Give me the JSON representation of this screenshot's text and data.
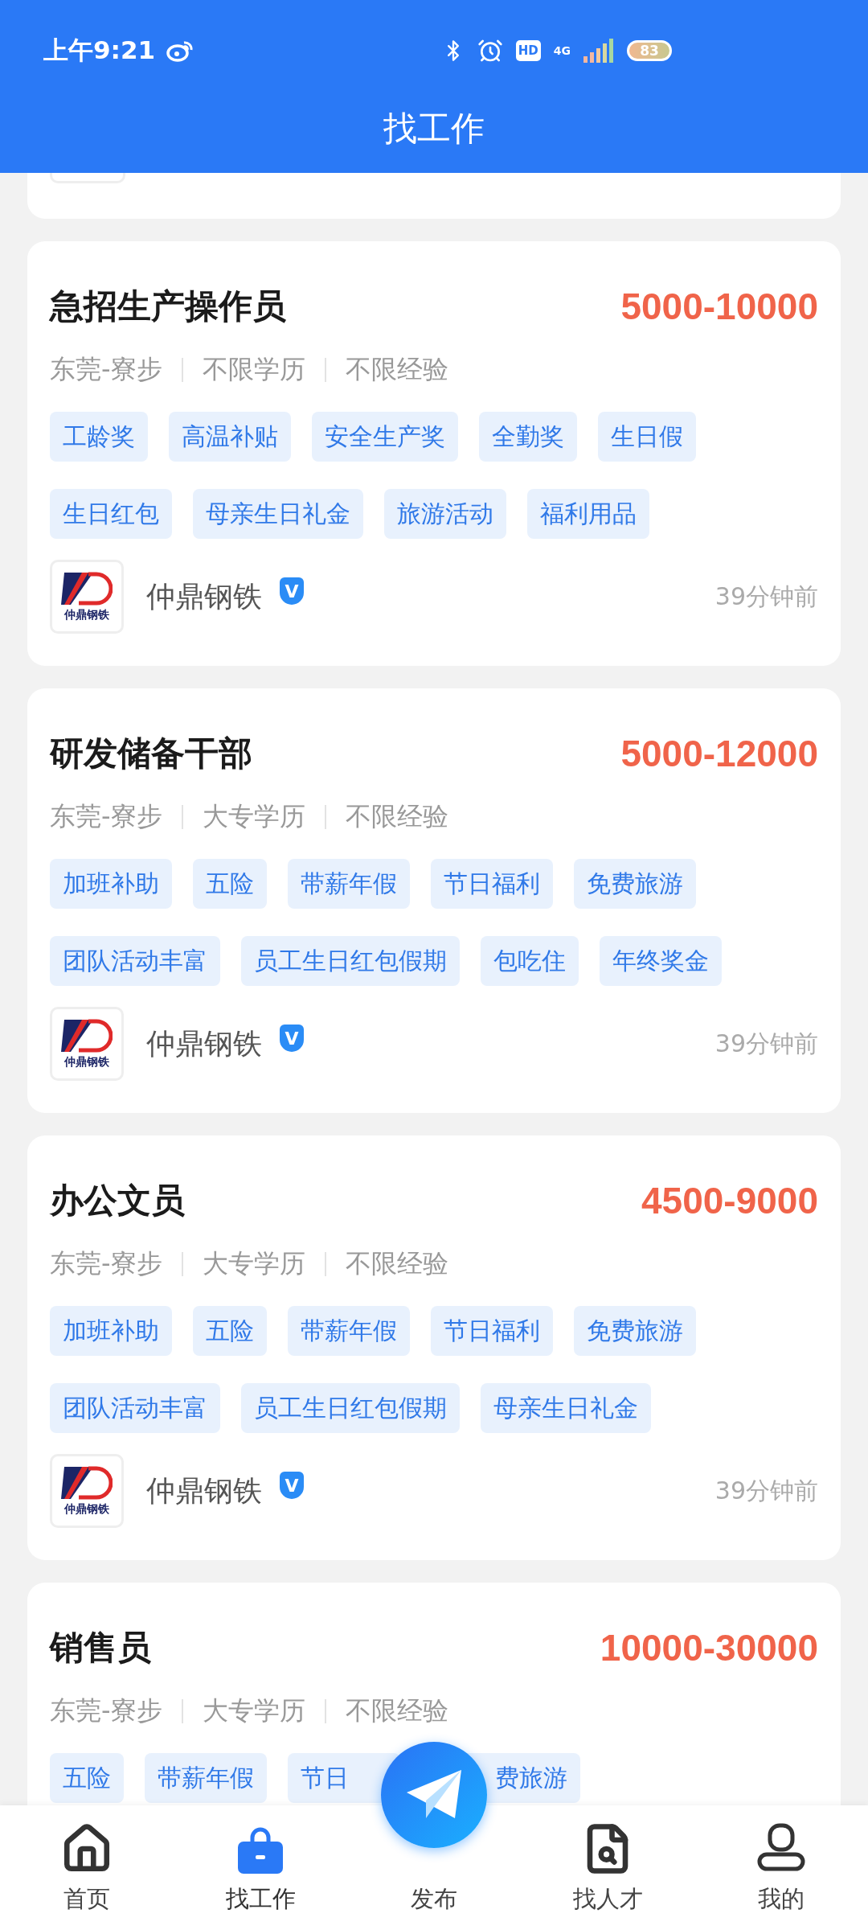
{
  "status_bar": {
    "time": "上午9:21",
    "hd": "HD",
    "network": "4G",
    "battery": "83"
  },
  "header": {
    "title": "找工作"
  },
  "jobs": [
    {
      "title": "急招生产操作员",
      "salary": "5000-10000",
      "meta": [
        "东莞-寮步",
        "不限学历",
        "不限经验"
      ],
      "tags": [
        "工龄奖",
        "高温补贴",
        "安全生产奖",
        "全勤奖",
        "生日假",
        "生日红包",
        "母亲生日礼金",
        "旅游活动",
        "福利用品"
      ],
      "company": "仲鼎钢铁",
      "logo_text": "仲鼎钢铁",
      "badge": "V",
      "time": "39分钟前"
    },
    {
      "title": "研发储备干部",
      "salary": "5000-12000",
      "meta": [
        "东莞-寮步",
        "大专学历",
        "不限经验"
      ],
      "tags": [
        "加班补助",
        "五险",
        "带薪年假",
        "节日福利",
        "免费旅游",
        "团队活动丰富",
        "员工生日红包假期",
        "包吃住",
        "年终奖金"
      ],
      "company": "仲鼎钢铁",
      "logo_text": "仲鼎钢铁",
      "badge": "V",
      "time": "39分钟前"
    },
    {
      "title": "办公文员",
      "salary": "4500-9000",
      "meta": [
        "东莞-寮步",
        "大专学历",
        "不限经验"
      ],
      "tags": [
        "加班补助",
        "五险",
        "带薪年假",
        "节日福利",
        "免费旅游",
        "团队活动丰富",
        "员工生日红包假期",
        "母亲生日礼金"
      ],
      "company": "仲鼎钢铁",
      "logo_text": "仲鼎钢铁",
      "badge": "V",
      "time": "39分钟前"
    },
    {
      "title": "销售员",
      "salary": "10000-30000",
      "meta": [
        "东莞-寮步",
        "大专学历",
        "不限经验"
      ],
      "tags": [
        "五险",
        "带薪年假",
        {
          "text": "节日",
          "covered_end": true
        },
        {
          "text": "费旅游",
          "covered_start": true
        }
      ]
    }
  ],
  "nav": [
    {
      "kind": "home",
      "label": "首页",
      "selected": false
    },
    {
      "kind": "jobs",
      "label": "找工作",
      "selected": true
    },
    {
      "kind": "post",
      "label": "发布",
      "selected": false
    },
    {
      "kind": "talent",
      "label": "找人才",
      "selected": false
    },
    {
      "kind": "me",
      "label": "我的",
      "selected": false
    }
  ]
}
